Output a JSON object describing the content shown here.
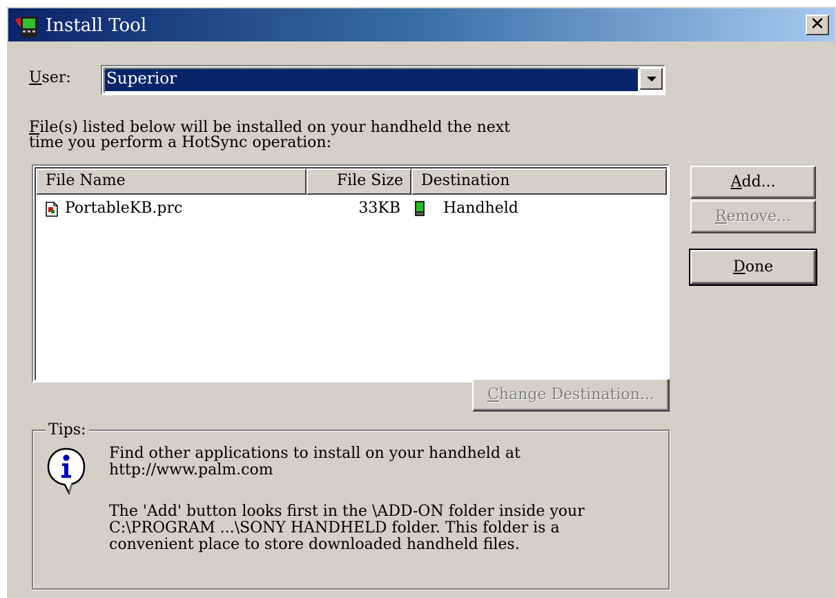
{
  "window": {
    "title": "Install Tool",
    "close_glyph": "✕"
  },
  "user": {
    "label_accel": "U",
    "label_rest": "ser:",
    "selected": "Superior"
  },
  "intro": {
    "line1_accel": "F",
    "line1_rest": "ile(s) listed below will be installed on your handheld the next",
    "line2": "time you perform a HotSync operation:"
  },
  "files": {
    "columns": [
      "File Name",
      "File Size",
      "Destination"
    ],
    "rows": [
      {
        "name": "PortableKB.prc",
        "size": "33KB",
        "destination": "Handheld",
        "file_icon": "prc-file-icon",
        "destination_icon": "handheld-device-icon"
      }
    ]
  },
  "buttons": {
    "add_accel": "A",
    "add_rest": "dd...",
    "remove_accel": "R",
    "remove_rest": "emove...",
    "done_accel": "D",
    "done_rest": "one",
    "change_accel": "C",
    "change_rest": "hange Destination..."
  },
  "tips": {
    "legend": "Tips:",
    "icon": "info-balloon-icon",
    "p1_line1": "Find other applications to install on your handheld at",
    "p1_line2": "http://www.palm.com",
    "p2_line1": "The 'Add' button looks first in the \\ADD-ON folder inside your",
    "p2_line2": "C:\\PROGRAM ...\\SONY HANDHELD folder. This folder is a",
    "p2_line3": "convenient place to store downloaded handheld files."
  },
  "colors": {
    "face": "#d4d0c8",
    "title_start": "#0a246a",
    "title_end": "#a6caf0",
    "selection": "#0a246a",
    "disabled_text": "#808080"
  }
}
